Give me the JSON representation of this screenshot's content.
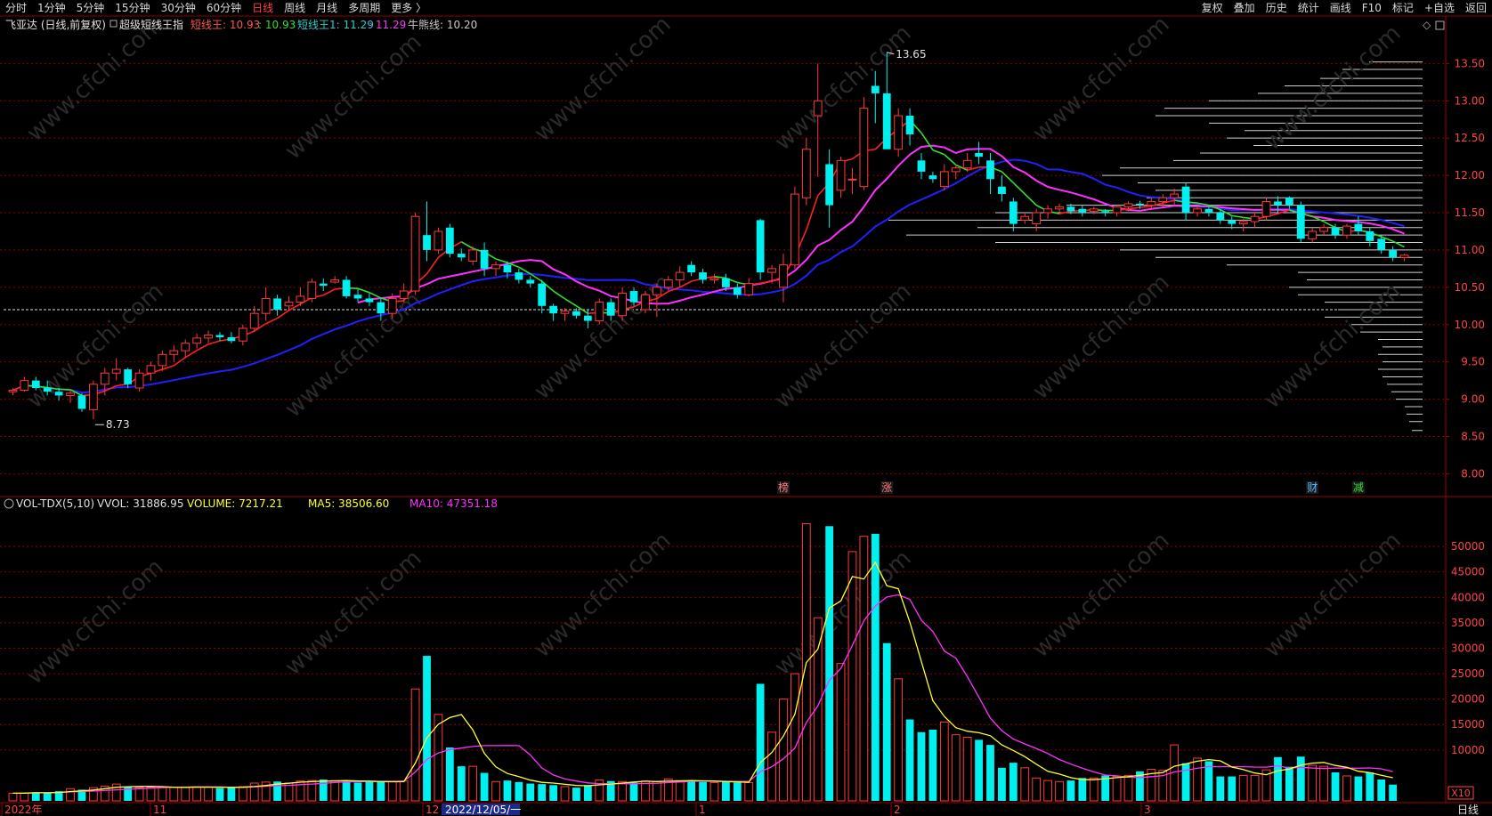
{
  "toolbar": {
    "period_tabs": [
      "分时",
      "1分钟",
      "5分钟",
      "15分钟",
      "30分钟",
      "60分钟",
      "日线",
      "周线",
      "月线",
      "多周期",
      "更多 〉"
    ],
    "active_tab": "日线",
    "right_tools": [
      "复权",
      "叠加",
      "历史",
      "统计",
      "画线",
      "F10",
      "标记",
      "+自选",
      "返回"
    ]
  },
  "main_header": {
    "stock": "飞亚达 (日线,前复权)",
    "indicator": "超级短线王指",
    "items": [
      {
        "label": "短线王: 10.93",
        "color": "#ff5555"
      },
      {
        "label": ": 10.93",
        "color": "#33dd33"
      },
      {
        "label": "短线王1: 11.29",
        "color": "#33cccc"
      },
      {
        "label": ": 11.29",
        "color": "#ff33ff"
      },
      {
        "label": "牛熊线: 10.20",
        "color": "#c8c8c8"
      }
    ]
  },
  "price_axis": [
    "13.50",
    "13.00",
    "12.50",
    "12.00",
    "11.50",
    "11.00",
    "10.50",
    "10.00",
    "9.50",
    "9.00",
    "8.50",
    "8.00"
  ],
  "price_range": [
    7.85,
    13.85
  ],
  "high_label": "13.65",
  "low_label": "8.73",
  "event_markers": [
    {
      "text": "榜",
      "color": "#ff7777"
    },
    {
      "text": "涨",
      "color": "#ff7777"
    },
    {
      "text": "财",
      "color": "#55bbff"
    },
    {
      "text": "减",
      "color": "#33dd33"
    }
  ],
  "vol_header": {
    "name": "VOL-TDX(5,10)",
    "vvol": "VVOL: 31886.95",
    "volume": "VOLUME: 7217.21",
    "ma5": "MA5: 38506.60",
    "ma10": "MA10: 47351.18"
  },
  "vol_axis": [
    "50000",
    "45000",
    "40000",
    "35000",
    "30000",
    "25000",
    "20000",
    "15000",
    "10000"
  ],
  "vol_unit": "X10",
  "vol_max": 56500,
  "date_axis": [
    "2022年",
    "11",
    "12",
    "2022/12/05/一",
    "1",
    "2",
    "3"
  ],
  "period_label": "日线",
  "watermark": "www.cfchi.com",
  "colors": {
    "up": "#ff3a3a",
    "down": "#00f0f0",
    "ma_red": "#ff2020",
    "ma_green": "#30e030",
    "ma_magenta": "#ff30ff",
    "ma_blue": "#2020ff",
    "grid": "#8b0000",
    "vol_ma5": "#ffff30",
    "vol_ma10": "#ff30ff"
  },
  "chart_data": {
    "type": "candlestick",
    "candles": [
      [
        9.1,
        9.15,
        9.05,
        9.12
      ],
      [
        9.12,
        9.3,
        9.1,
        9.25
      ],
      [
        9.25,
        9.3,
        9.12,
        9.15
      ],
      [
        9.15,
        9.25,
        9.05,
        9.1
      ],
      [
        9.1,
        9.15,
        8.98,
        9.05
      ],
      [
        9.05,
        9.12,
        8.95,
        9.08
      ],
      [
        9.05,
        9.08,
        8.83,
        8.87
      ],
      [
        8.86,
        9.25,
        8.73,
        9.2
      ],
      [
        9.2,
        9.42,
        9.05,
        9.35
      ],
      [
        9.35,
        9.55,
        9.25,
        9.4
      ],
      [
        9.4,
        9.42,
        9.15,
        9.2
      ],
      [
        9.15,
        9.4,
        9.1,
        9.35
      ],
      [
        9.35,
        9.5,
        9.25,
        9.45
      ],
      [
        9.45,
        9.65,
        9.38,
        9.6
      ],
      [
        9.6,
        9.72,
        9.5,
        9.65
      ],
      [
        9.65,
        9.8,
        9.55,
        9.75
      ],
      [
        9.75,
        9.88,
        9.68,
        9.82
      ],
      [
        9.82,
        9.92,
        9.75,
        9.86
      ],
      [
        9.86,
        9.9,
        9.78,
        9.83
      ],
      [
        9.83,
        9.9,
        9.75,
        9.78
      ],
      [
        9.78,
        10.0,
        9.72,
        9.95
      ],
      [
        9.95,
        10.25,
        9.9,
        10.15
      ],
      [
        10.15,
        10.5,
        10.05,
        10.35
      ],
      [
        10.35,
        10.4,
        10.12,
        10.2
      ],
      [
        10.25,
        10.38,
        10.18,
        10.3
      ],
      [
        10.3,
        10.5,
        10.25,
        10.38
      ],
      [
        10.35,
        10.62,
        10.3,
        10.57
      ],
      [
        10.55,
        10.62,
        10.45,
        10.52
      ],
      [
        10.57,
        10.65,
        10.55,
        10.6
      ],
      [
        10.6,
        10.65,
        10.35,
        10.38
      ],
      [
        10.4,
        10.48,
        10.3,
        10.35
      ],
      [
        10.35,
        10.42,
        10.25,
        10.3
      ],
      [
        10.3,
        10.35,
        10.05,
        10.15
      ],
      [
        10.15,
        10.42,
        10.08,
        10.35
      ],
      [
        10.35,
        10.55,
        10.3,
        10.45
      ],
      [
        10.45,
        11.5,
        10.4,
        11.45
      ],
      [
        11.2,
        11.65,
        10.85,
        11.0
      ],
      [
        11.0,
        11.3,
        10.95,
        11.25
      ],
      [
        11.3,
        11.35,
        10.9,
        10.95
      ],
      [
        10.95,
        11.02,
        10.85,
        10.9
      ],
      [
        10.85,
        11.05,
        10.8,
        11.0
      ],
      [
        11.0,
        11.1,
        10.65,
        10.75
      ],
      [
        10.75,
        10.85,
        10.65,
        10.8
      ],
      [
        10.8,
        10.85,
        10.62,
        10.7
      ],
      [
        10.7,
        10.75,
        10.55,
        10.6
      ],
      [
        10.6,
        10.65,
        10.5,
        10.55
      ],
      [
        10.55,
        10.6,
        10.15,
        10.25
      ],
      [
        10.25,
        10.28,
        10.05,
        10.15
      ],
      [
        10.15,
        10.22,
        10.05,
        10.18
      ],
      [
        10.18,
        10.22,
        10.08,
        10.12
      ],
      [
        10.12,
        10.2,
        9.95,
        10.05
      ],
      [
        10.05,
        10.35,
        10.0,
        10.3
      ],
      [
        10.3,
        10.35,
        10.05,
        10.12
      ],
      [
        10.12,
        10.5,
        10.05,
        10.42
      ],
      [
        10.45,
        10.5,
        10.25,
        10.3
      ],
      [
        10.2,
        10.45,
        10.15,
        10.4
      ],
      [
        10.4,
        10.55,
        10.1,
        10.5
      ],
      [
        10.5,
        10.65,
        10.45,
        10.6
      ],
      [
        10.6,
        10.78,
        10.5,
        10.7
      ],
      [
        10.8,
        10.85,
        10.65,
        10.7
      ],
      [
        10.7,
        10.75,
        10.55,
        10.6
      ],
      [
        10.6,
        10.68,
        10.55,
        10.62
      ],
      [
        10.62,
        10.68,
        10.45,
        10.5
      ],
      [
        10.5,
        10.55,
        10.35,
        10.4
      ],
      [
        10.4,
        10.62,
        10.38,
        10.55
      ],
      [
        11.4,
        11.42,
        10.6,
        10.7
      ],
      [
        10.7,
        10.8,
        10.55,
        10.75
      ],
      [
        10.5,
        10.95,
        10.3,
        10.8
      ],
      [
        10.8,
        11.85,
        10.75,
        11.75
      ],
      [
        11.7,
        12.5,
        11.6,
        12.35
      ],
      [
        12.8,
        13.5,
        11.98,
        13.0
      ],
      [
        12.15,
        12.35,
        11.3,
        11.6
      ],
      [
        11.8,
        12.25,
        11.7,
        12.2
      ],
      [
        11.95,
        12.1,
        11.75,
        11.95
      ],
      [
        11.85,
        13.05,
        11.8,
        12.9
      ],
      [
        13.2,
        13.4,
        12.7,
        13.1
      ],
      [
        13.1,
        13.65,
        12.5,
        12.35
      ],
      [
        12.35,
        12.9,
        12.25,
        12.8
      ],
      [
        12.8,
        12.9,
        12.4,
        12.55
      ],
      [
        12.2,
        12.3,
        11.95,
        12.05
      ],
      [
        12.0,
        12.05,
        11.9,
        11.95
      ],
      [
        11.85,
        12.15,
        11.8,
        12.05
      ],
      [
        12.05,
        12.15,
        11.95,
        12.1
      ],
      [
        12.1,
        12.3,
        12.05,
        12.2
      ],
      [
        12.3,
        12.45,
        12.15,
        12.25
      ],
      [
        12.2,
        12.3,
        11.75,
        11.95
      ],
      [
        11.85,
        12.0,
        11.65,
        11.75
      ],
      [
        11.65,
        11.7,
        11.25,
        11.35
      ],
      [
        11.4,
        11.5,
        11.35,
        11.45
      ],
      [
        11.35,
        11.55,
        11.25,
        11.5
      ],
      [
        11.5,
        11.6,
        11.42,
        11.55
      ],
      [
        11.55,
        11.62,
        11.48,
        11.58
      ],
      [
        11.58,
        11.62,
        11.48,
        11.52
      ],
      [
        11.55,
        11.6,
        11.45,
        11.5
      ],
      [
        11.52,
        11.58,
        11.48,
        11.55
      ],
      [
        11.52,
        11.55,
        11.45,
        11.5
      ],
      [
        11.5,
        11.6,
        11.45,
        11.58
      ],
      [
        11.58,
        11.65,
        11.52,
        11.62
      ],
      [
        11.62,
        11.66,
        11.55,
        11.6
      ],
      [
        11.6,
        11.7,
        11.55,
        11.65
      ],
      [
        11.65,
        11.75,
        11.58,
        11.7
      ],
      [
        11.7,
        11.82,
        11.6,
        11.75
      ],
      [
        11.85,
        11.9,
        11.4,
        11.5
      ],
      [
        11.5,
        11.6,
        11.45,
        11.55
      ],
      [
        11.55,
        11.6,
        11.45,
        11.5
      ],
      [
        11.5,
        11.55,
        11.35,
        11.4
      ],
      [
        11.4,
        11.45,
        11.28,
        11.35
      ],
      [
        11.35,
        11.42,
        11.25,
        11.38
      ],
      [
        11.38,
        11.5,
        11.3,
        11.45
      ],
      [
        11.45,
        11.7,
        11.4,
        11.65
      ],
      [
        11.65,
        11.72,
        11.5,
        11.6
      ],
      [
        11.7,
        11.72,
        11.55,
        11.6
      ],
      [
        11.6,
        11.65,
        11.1,
        11.15
      ],
      [
        11.15,
        11.3,
        11.1,
        11.25
      ],
      [
        11.25,
        11.35,
        11.2,
        11.3
      ],
      [
        11.3,
        11.35,
        11.15,
        11.2
      ],
      [
        11.2,
        11.35,
        11.15,
        11.32
      ],
      [
        11.35,
        11.45,
        11.2,
        11.25
      ],
      [
        11.25,
        11.3,
        11.05,
        11.12
      ],
      [
        11.15,
        11.2,
        10.95,
        11.0
      ],
      [
        11.0,
        11.05,
        10.85,
        10.9
      ],
      [
        10.9,
        10.95,
        10.85,
        10.93
      ]
    ],
    "volume": [
      1500,
      1550,
      1700,
      1600,
      1900,
      2400,
      2200,
      2600,
      2900,
      3300,
      2800,
      2600,
      2700,
      2600,
      2700,
      2700,
      2800,
      2700,
      2500,
      2600,
      2800,
      3500,
      3700,
      3800,
      3500,
      3900,
      4000,
      4200,
      4000,
      3800,
      3600,
      3800,
      3800,
      3800,
      3900,
      22000,
      28500,
      17000,
      10500,
      6800,
      6800,
      5500,
      3800,
      4000,
      3700,
      3400,
      3300,
      3100,
      2800,
      2600,
      3100,
      4100,
      3900,
      3800,
      3600,
      3900,
      3800,
      4300,
      4000,
      3900,
      3700,
      3600,
      3800,
      3600,
      3600,
      23000,
      13500,
      20000,
      25000,
      54500,
      36000,
      54000,
      27000,
      49000,
      52000,
      52500,
      31000,
      24000,
      16000,
      13500,
      14000,
      15500,
      13000,
      12500,
      12000,
      11000,
      6500,
      7500,
      6500,
      4500,
      4000,
      3800,
      4000,
      4500,
      4500,
      5000,
      4800,
      5000,
      5800,
      6200,
      6000,
      11000,
      7400,
      8400,
      7800,
      4800,
      4800,
      5000,
      5000,
      6100,
      8600,
      6700,
      8700,
      7000,
      6800,
      5600,
      4900,
      4800,
      5600,
      4200,
      3200
    ],
    "price_ylim": [
      7.85,
      13.85
    ],
    "volume_ylim": [
      0,
      56500
    ]
  }
}
